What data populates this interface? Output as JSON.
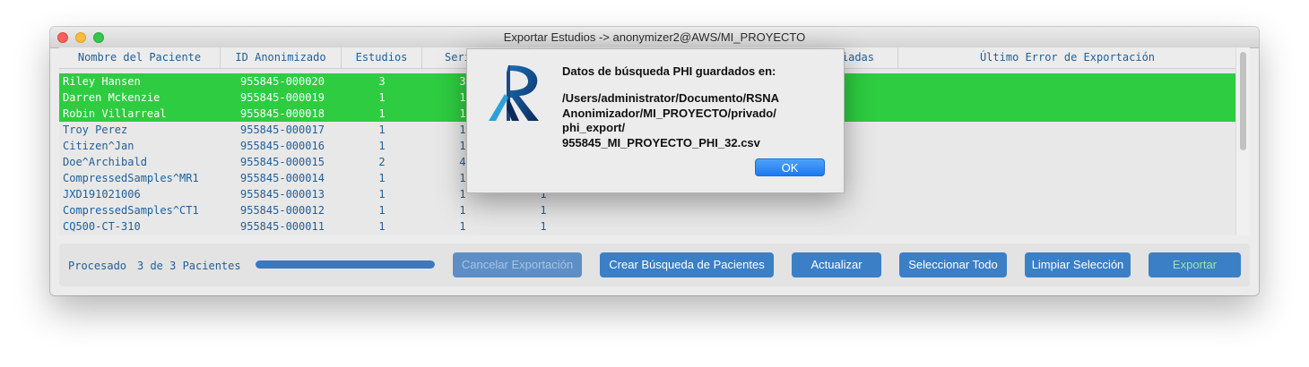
{
  "window": {
    "title": "Exportar Estudios -> anonymizer2@AWS/MI_PROYECTO"
  },
  "table": {
    "headers": {
      "name": "Nombre del Paciente",
      "id": "ID Anonimizado",
      "studies": "Estudios",
      "series_partial": "Seri",
      "sent_partial": "iadas",
      "last_error": "Último Error de Exportación"
    },
    "rows": [
      {
        "name": "Riley Hansen",
        "id": "955845-000020",
        "studies": "3",
        "series": "3",
        "instances": "",
        "selected": true
      },
      {
        "name": "Darren Mckenzie",
        "id": "955845-000019",
        "studies": "1",
        "series": "1",
        "instances": "",
        "selected": true
      },
      {
        "name": "Robin Villarreal",
        "id": "955845-000018",
        "studies": "1",
        "series": "1",
        "instances": "",
        "selected": true
      },
      {
        "name": "Troy Perez",
        "id": "955845-000017",
        "studies": "1",
        "series": "1",
        "instances": "",
        "selected": false
      },
      {
        "name": "Citizen^Jan",
        "id": "955845-000016",
        "studies": "1",
        "series": "1",
        "instances": "",
        "selected": false
      },
      {
        "name": "Doe^Archibald",
        "id": "955845-000015",
        "studies": "2",
        "series": "4",
        "instances": "",
        "selected": false
      },
      {
        "name": "CompressedSamples^MR1",
        "id": "955845-000014",
        "studies": "1",
        "series": "1",
        "instances": "",
        "selected": false
      },
      {
        "name": "JXD191021006",
        "id": "955845-000013",
        "studies": "1",
        "series": "1",
        "instances": "1",
        "selected": false
      },
      {
        "name": "CompressedSamples^CT1",
        "id": "955845-000012",
        "studies": "1",
        "series": "1",
        "instances": "1",
        "selected": false
      },
      {
        "name": "CQ500-CT-310",
        "id": "955845-000011",
        "studies": "1",
        "series": "1",
        "instances": "1",
        "selected": false
      }
    ]
  },
  "footer": {
    "processed_label": "Procesado",
    "processed_count": "3 de 3 Pacientes",
    "progress_fraction": 1.0,
    "buttons": {
      "cancel": "Cancelar Exportación",
      "create_search": "Crear Búsqueda de Pacientes",
      "refresh": "Actualizar",
      "select_all": "Seleccionar Todo",
      "clear_selection": "Limpiar Selección",
      "export": "Exportar"
    }
  },
  "dialog": {
    "heading": "Datos de búsqueda PHI guardados en:",
    "path_lines": [
      "/Users/administrator/Documento/RSNA",
      "Anonimizador/MI_PROYECTO/privado/",
      "phi_export/",
      "955845_MI_PROYECTO_PHI_32.csv"
    ],
    "ok_label": "OK",
    "logo_letter": "R"
  },
  "colors": {
    "selection": "#2ecc40",
    "text_blue": "#1f5f99",
    "button_blue": "#3b7fc6"
  }
}
